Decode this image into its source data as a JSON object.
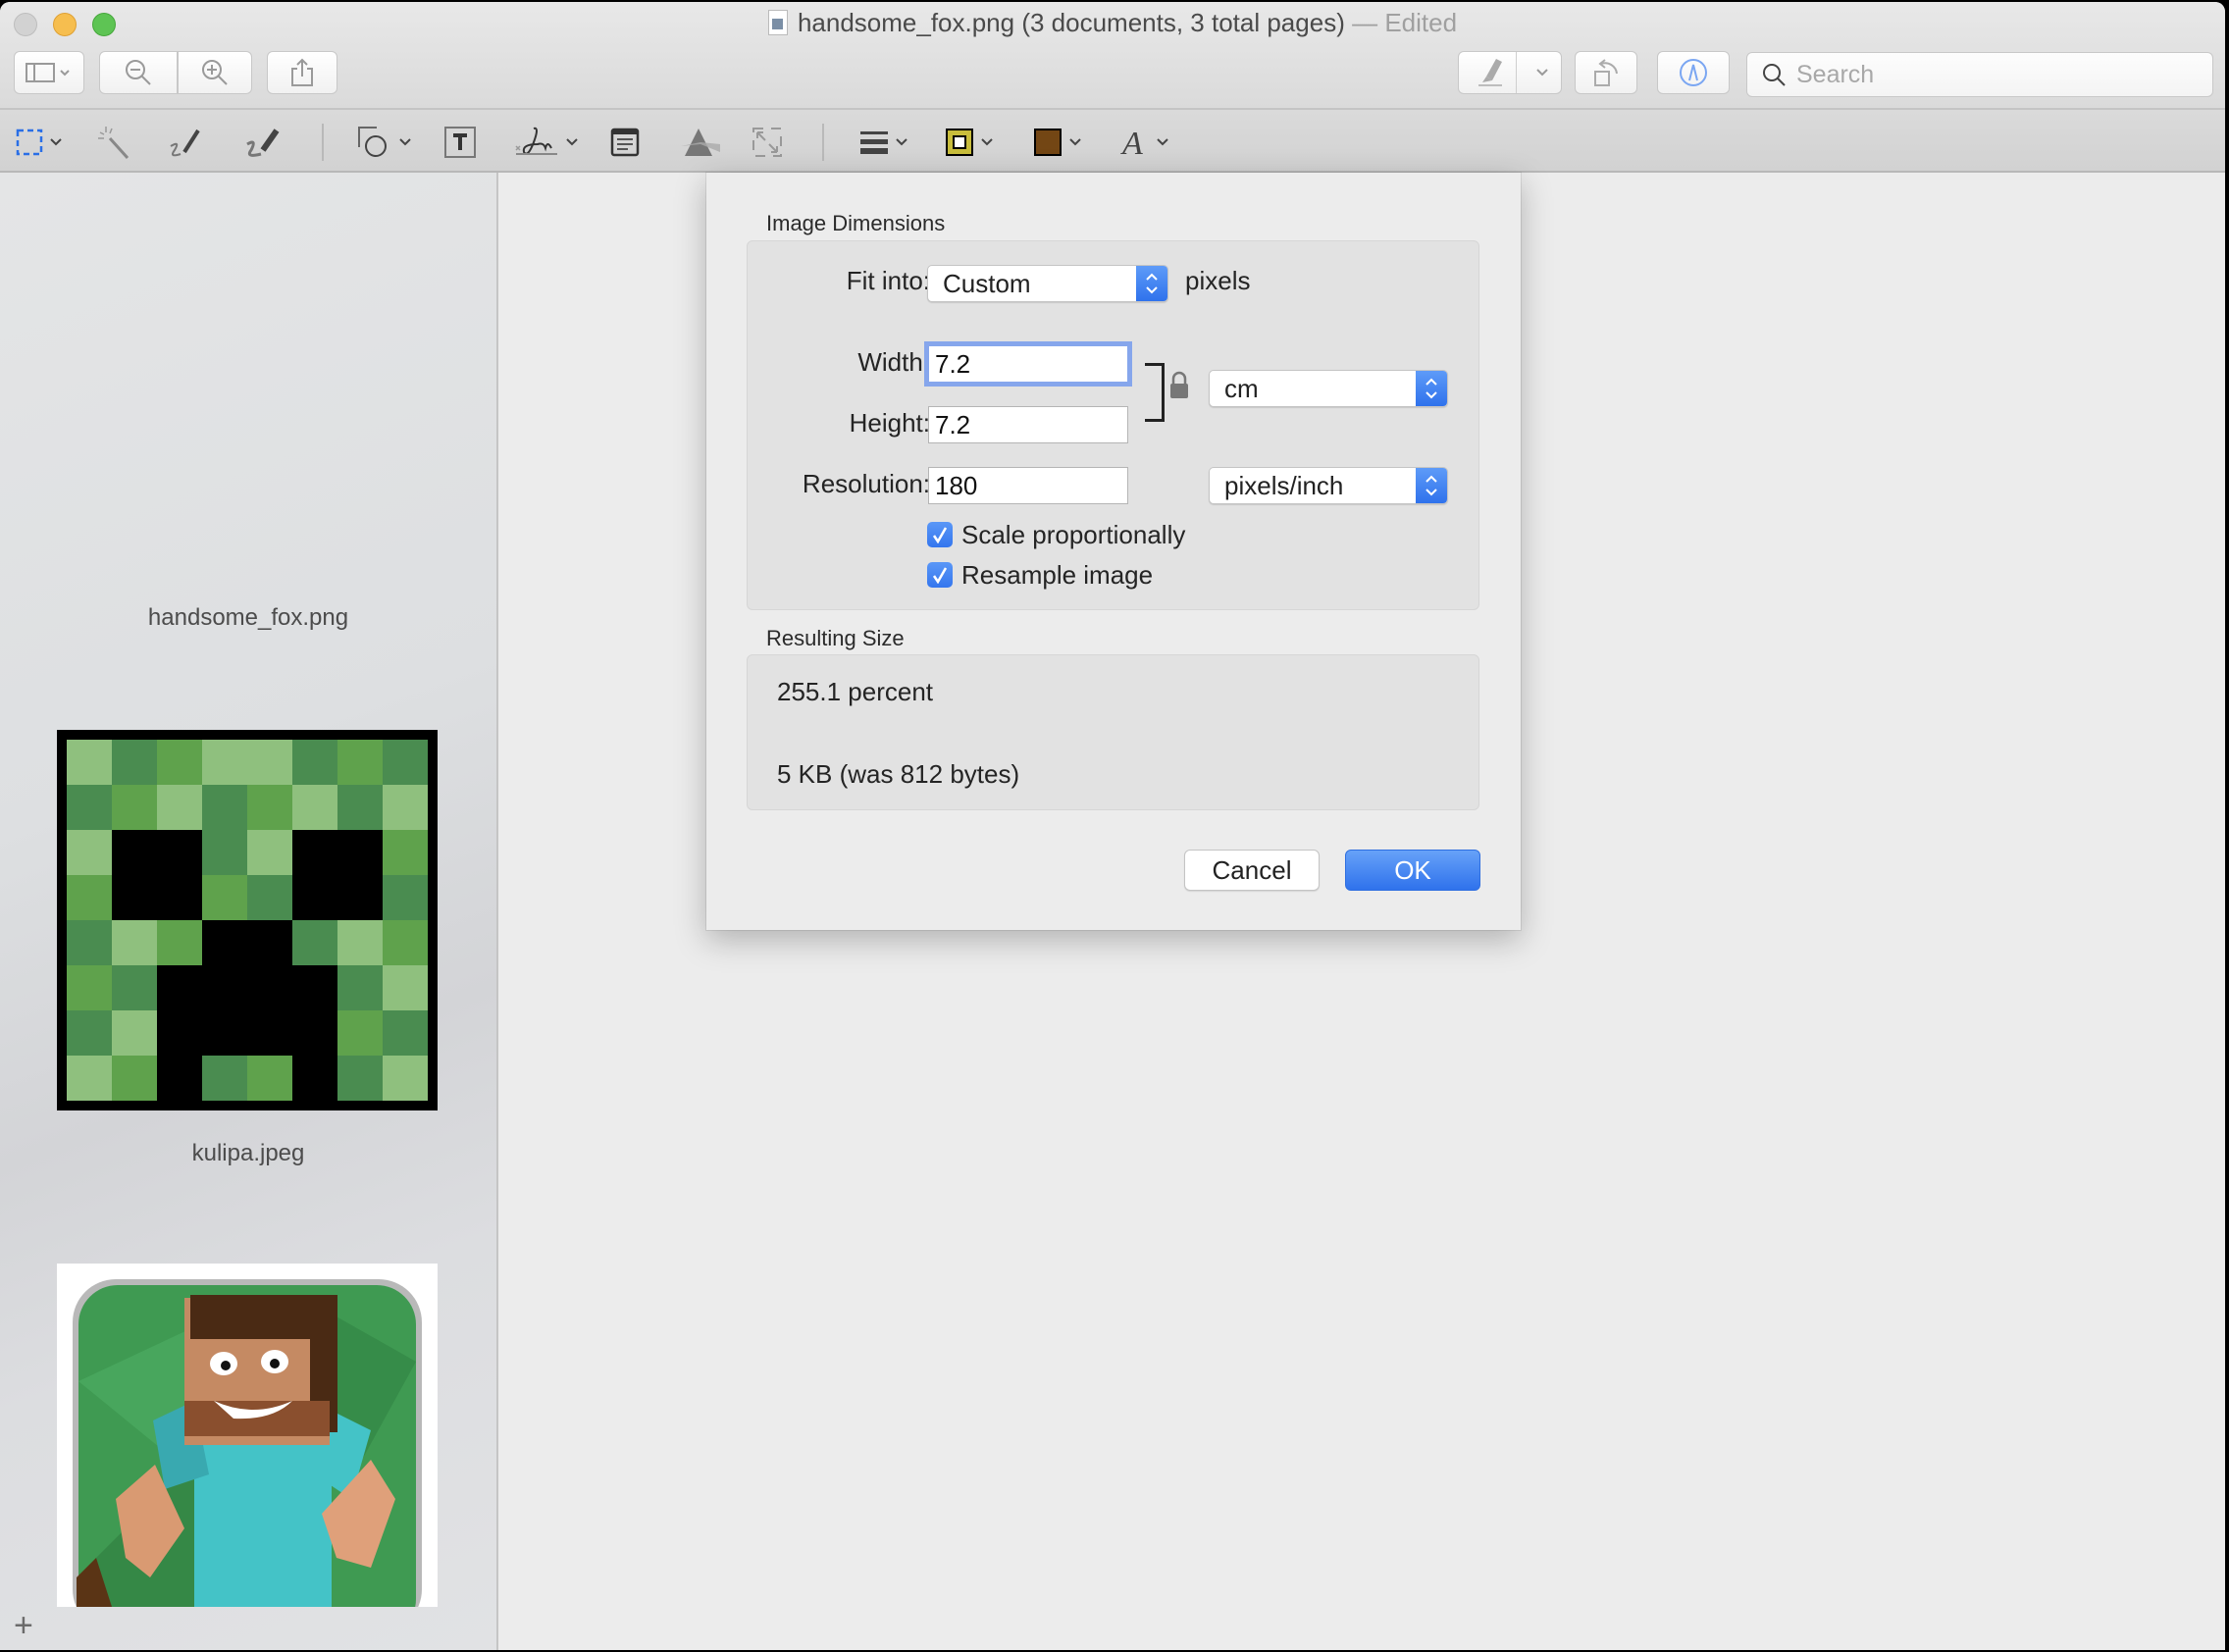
{
  "window": {
    "title": "handsome_fox.png (3 documents, 3 total pages)",
    "title_separator": " — ",
    "edited_label": "Edited"
  },
  "toolbar": {
    "search": {
      "placeholder": "Search",
      "value": ""
    },
    "buttons": [
      "sidebar-toggle",
      "zoom-out",
      "zoom-in",
      "share",
      "highlight",
      "rotate",
      "markup"
    ],
    "markup_tools": [
      "rectangular-selection",
      "instant-alpha",
      "sketch",
      "draw",
      "shapes",
      "text",
      "sign",
      "note",
      "adjust-color",
      "adjust-size",
      "shape-style",
      "border-color",
      "fill-color",
      "text-style"
    ],
    "colors": {
      "border_color": "#c8bd3c",
      "fill_color": "#734614",
      "selection_accent": "#2a6fe6"
    }
  },
  "sidebar": {
    "items": [
      {
        "label": "handsome_fox.png",
        "thumbnail": "blank"
      },
      {
        "label": "kulipa.jpeg",
        "thumbnail": "creeper-face"
      },
      {
        "label": "",
        "thumbnail": "steve-character"
      }
    ],
    "add_label": "+"
  },
  "dialog": {
    "image_dimensions_title": "Image Dimensions",
    "fit_into": {
      "label": "Fit into:",
      "value": "Custom",
      "suffix": "pixels"
    },
    "width": {
      "label": "Width:",
      "value": "7.2"
    },
    "height": {
      "label": "Height:",
      "value": "7.2"
    },
    "units": {
      "value": "cm"
    },
    "resolution": {
      "label": "Resolution:",
      "value": "180",
      "unit": "pixels/inch"
    },
    "scale_proportionally": {
      "label": "Scale proportionally",
      "checked": true
    },
    "resample_image": {
      "label": "Resample image",
      "checked": true
    },
    "resulting_size_title": "Resulting Size",
    "result_percent": "255.1 percent",
    "result_size": "5 KB (was 812 bytes)",
    "cancel_label": "Cancel",
    "ok_label": "OK"
  },
  "creeper_grid": [
    "LDMLLDMD",
    "DMLDMLDL",
    "LKKDLKKM",
    "MKKMDKKD",
    "DLMKKDLM",
    "MDKKKKDL",
    "DLKKKKMD",
    "LMKDMKDL"
  ],
  "creeper_colors": {
    "L": "#8fc07e",
    "M": "#5fa24c",
    "D": "#4a8c50",
    "K": "#000000"
  }
}
